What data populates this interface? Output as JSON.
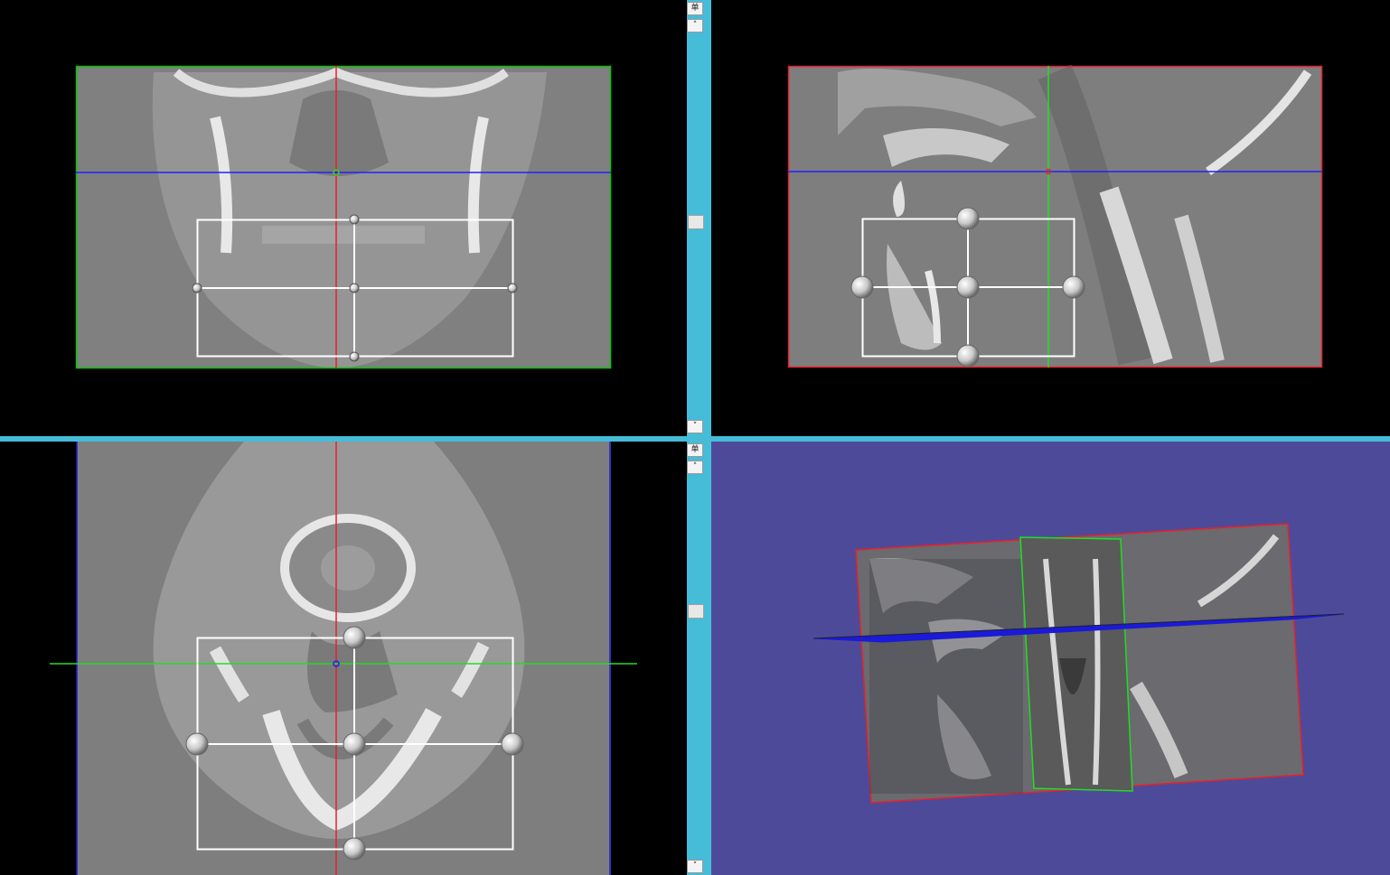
{
  "views": {
    "coronal": {
      "name": "coronal-view",
      "frame_color": "#00c800"
    },
    "sagittal": {
      "name": "sagittal-view",
      "frame_color": "#e8202a"
    },
    "axial": {
      "name": "axial-view",
      "frame_color": "#1a1ad8"
    },
    "volume_3d": {
      "name": "3d-view",
      "background": "#4d4b99"
    }
  },
  "crosshair_colors": {
    "red": "#e8202a",
    "green": "#22dd22",
    "blue": "#2020ff"
  },
  "scrollbars": [
    {
      "top_label": "单",
      "up_icon": "˄",
      "down_icon": "˅"
    },
    {
      "top_label": "单",
      "up_icon": "˄",
      "down_icon": "˅"
    }
  ]
}
